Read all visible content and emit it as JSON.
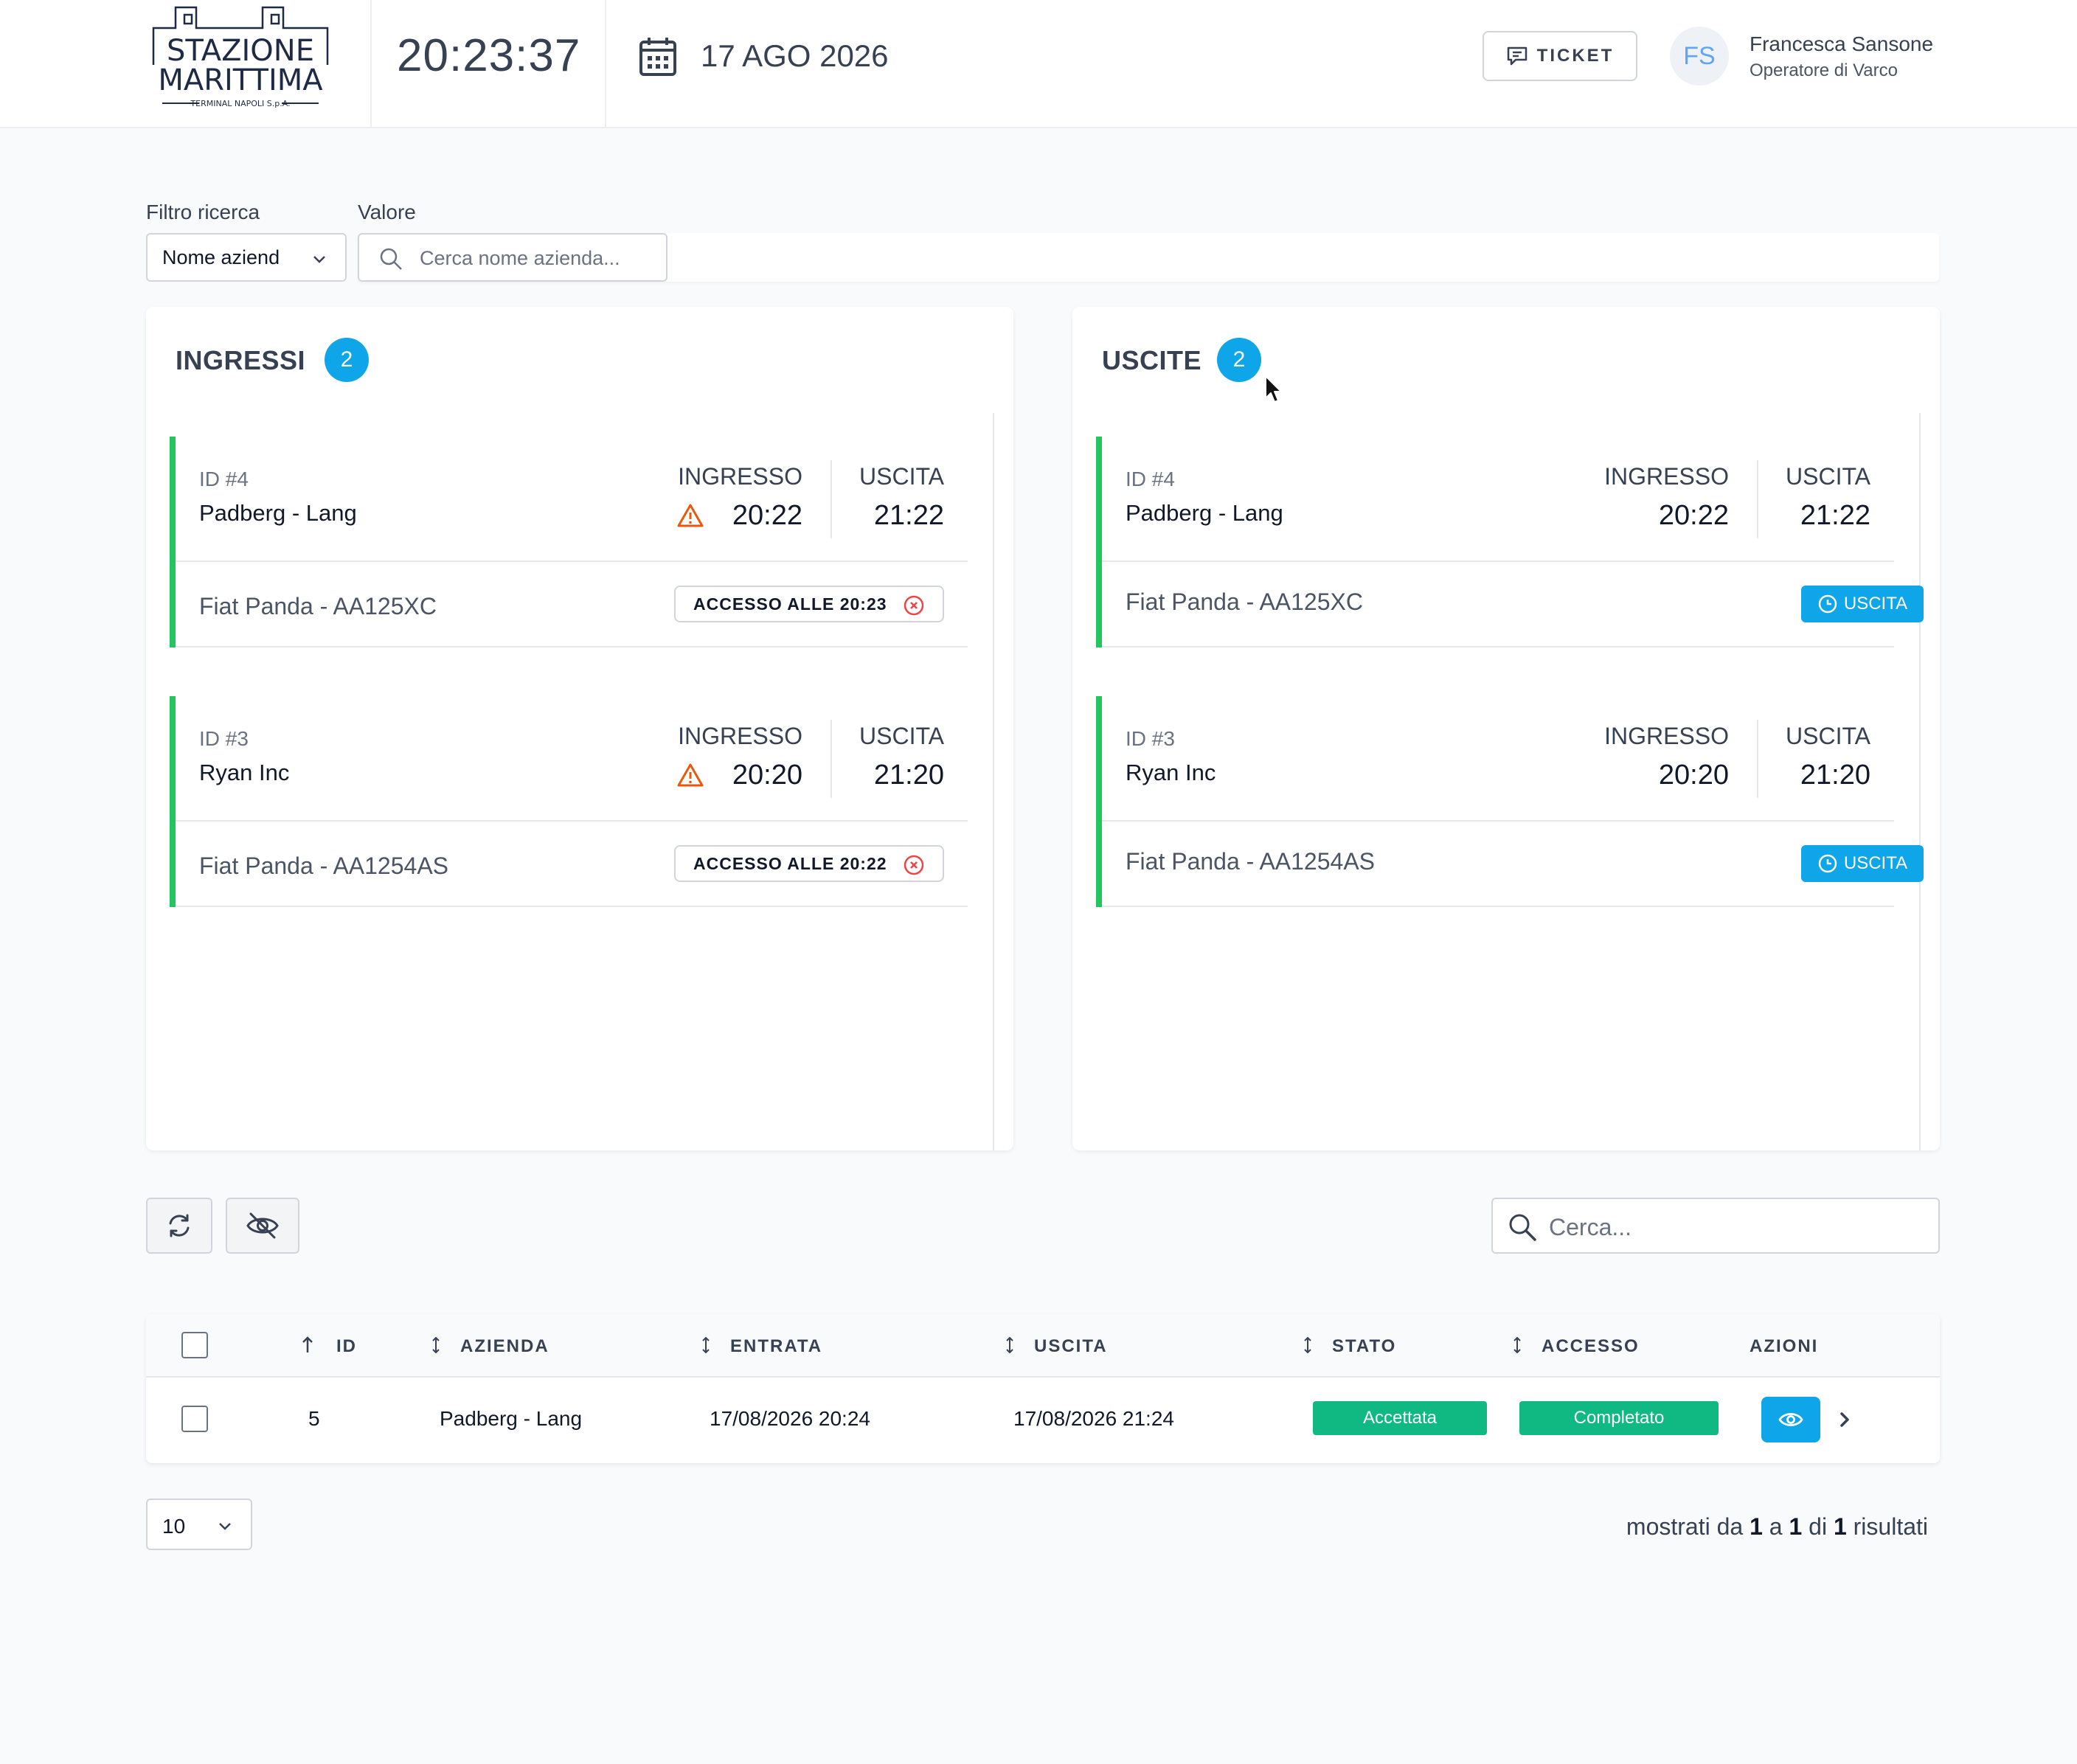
{
  "header": {
    "logo_line1": "STAZIONE",
    "logo_line2": "MARITTIMA",
    "logo_sub": "TERMINAL NAPOLI S.p.A.",
    "clock": "20:23:37",
    "date": "17 AGO 2026",
    "ticket_label": "TICKET",
    "user_initials": "FS",
    "user_name": "Francesca Sansone",
    "user_role": "Operatore di Varco"
  },
  "filter": {
    "filter_label": "Filtro ricerca",
    "filter_value": "Nome aziend",
    "value_label": "Valore",
    "search_placeholder": "Cerca nome azienda..."
  },
  "ingressi": {
    "title": "INGRESSI",
    "count": "2",
    "cards": [
      {
        "id": "ID #4",
        "company": "Padberg - Lang",
        "in_label": "INGRESSO",
        "in_time": "20:22",
        "out_label": "USCITA",
        "out_time": "21:22",
        "vehicle": "Fiat Panda - AA125XC",
        "access": "ACCESSO ALLE 20:23"
      },
      {
        "id": "ID #3",
        "company": "Ryan Inc",
        "in_label": "INGRESSO",
        "in_time": "20:20",
        "out_label": "USCITA",
        "out_time": "21:20",
        "vehicle": "Fiat Panda - AA1254AS",
        "access": "ACCESSO ALLE 20:22"
      }
    ]
  },
  "uscite": {
    "title": "USCITE",
    "count": "2",
    "cards": [
      {
        "id": "ID #4",
        "company": "Padberg - Lang",
        "in_label": "INGRESSO",
        "in_time": "20:22",
        "out_label": "USCITA",
        "out_time": "21:22",
        "vehicle": "Fiat Panda - AA125XC",
        "exit_label": "USCITA"
      },
      {
        "id": "ID #3",
        "company": "Ryan Inc",
        "in_label": "INGRESSO",
        "in_time": "20:20",
        "out_label": "USCITA",
        "out_time": "21:20",
        "vehicle": "Fiat Panda - AA1254AS",
        "exit_label": "USCITA"
      }
    ]
  },
  "toolbar": {
    "search_placeholder": "Cerca..."
  },
  "table": {
    "columns": [
      "ID",
      "AZIENDA",
      "ENTRATA",
      "USCITA",
      "STATO",
      "ACCESSO",
      "AZIONI"
    ],
    "rows": [
      {
        "id": "5",
        "company": "Padberg - Lang",
        "entry": "17/08/2026 20:24",
        "exit": "17/08/2026 21:24",
        "state": "Accettata",
        "access": "Completato"
      }
    ]
  },
  "pagination": {
    "page_size": "10",
    "results_prefix": "mostrati da",
    "from": "1",
    "to_word": "a",
    "to": "1",
    "of_word": "di",
    "total": "1",
    "results_suffix": "risultati"
  },
  "colors": {
    "accent": "#0ea5e9",
    "success": "#10b981",
    "card_bar": "#22c55e",
    "warning": "#ea580c"
  }
}
